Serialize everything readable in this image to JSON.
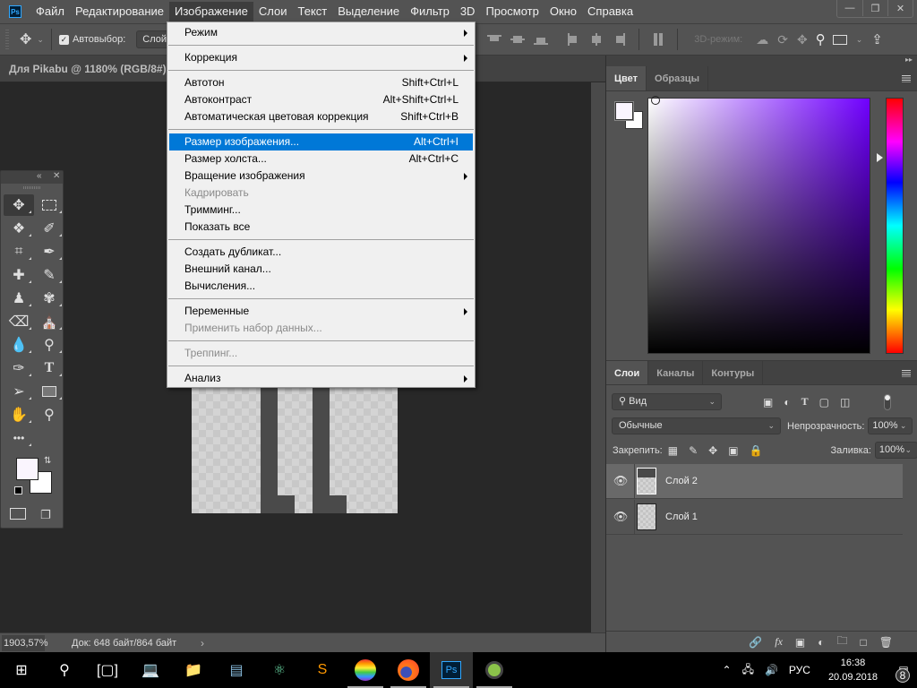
{
  "app": {
    "logo": "Ps",
    "document_title": "Для Pikabu @ 1180% (RGB/8#) *"
  },
  "menubar": {
    "items": [
      "Файл",
      "Редактирование",
      "Изображение",
      "Слои",
      "Текст",
      "Выделение",
      "Фильтр",
      "3D",
      "Просмотр",
      "Окно",
      "Справка"
    ],
    "active": "Изображение"
  },
  "window_controls": {
    "minimize": "minimize-icon",
    "restore": "restore-icon",
    "close": "close-icon"
  },
  "options_bar": {
    "autoselect_label": "Автовыбор:",
    "autoselect_checked": true,
    "autoselect_target": "Слой",
    "mode_3d_label": "3D-режим:"
  },
  "image_menu": {
    "items": [
      {
        "label": "Режим",
        "submenu": true
      },
      {
        "sep": true
      },
      {
        "label": "Коррекция",
        "submenu": true
      },
      {
        "sep": true
      },
      {
        "label": "Автотон",
        "shortcut": "Shift+Ctrl+L"
      },
      {
        "label": "Автоконтраст",
        "shortcut": "Alt+Shift+Ctrl+L"
      },
      {
        "label": "Автоматическая цветовая коррекция",
        "shortcut": "Shift+Ctrl+B"
      },
      {
        "sep": true
      },
      {
        "label": "Размер изображения...",
        "shortcut": "Alt+Ctrl+I",
        "highlighted": true
      },
      {
        "label": "Размер холста...",
        "shortcut": "Alt+Ctrl+C"
      },
      {
        "label": "Вращение изображения",
        "submenu": true
      },
      {
        "label": "Кадрировать",
        "disabled": true
      },
      {
        "label": "Тримминг..."
      },
      {
        "label": "Показать все"
      },
      {
        "sep": true
      },
      {
        "label": "Создать дубликат..."
      },
      {
        "label": "Внешний канал..."
      },
      {
        "label": "Вычисления..."
      },
      {
        "sep": true
      },
      {
        "label": "Переменные",
        "submenu": true
      },
      {
        "label": "Применить набор данных...",
        "disabled": true
      },
      {
        "sep": true
      },
      {
        "label": "Треппинг...",
        "disabled": true
      },
      {
        "sep": true
      },
      {
        "label": "Анализ",
        "submenu": true
      }
    ]
  },
  "tools": [
    "move",
    "rect-marquee",
    "polygonal-lasso",
    "quick-selection",
    "crop",
    "eyedropper",
    "healing-brush",
    "brush",
    "clone-stamp",
    "history-brush",
    "eraser",
    "paint-bucket",
    "blur",
    "dodge",
    "pen",
    "type",
    "path-selection",
    "rectangle",
    "hand-rotate",
    "zoom",
    "more"
  ],
  "swatches": {
    "foreground": "#faf5fe",
    "background": "#ffffff"
  },
  "color_panel": {
    "tabs": [
      "Цвет",
      "Образцы"
    ],
    "active_tab": "Цвет",
    "hue_color": "#7000ff"
  },
  "layers_panel": {
    "tabs": [
      "Слои",
      "Каналы",
      "Контуры"
    ],
    "active_tab": "Слои",
    "filter_label": "Вид",
    "blend_mode": "Обычные",
    "opacity_label": "Непрозрачность:",
    "opacity_value": "100%",
    "lock_label": "Закрепить:",
    "fill_label": "Заливка:",
    "fill_value": "100%",
    "layers": [
      {
        "name": "Слой 2",
        "visible": true,
        "selected": true
      },
      {
        "name": "Слой 1",
        "visible": true,
        "selected": false
      }
    ]
  },
  "status": {
    "zoom": "1903,57%",
    "doc_info": "Док: 648 байт/864 байт"
  },
  "taskbar": {
    "apps": [
      "start",
      "search",
      "task-view",
      "this-pc",
      "file-explorer",
      "terminal",
      "atom",
      "sublime",
      "color-app",
      "firefox",
      "photoshop",
      "misc-app"
    ],
    "active_app": "photoshop",
    "language": "РУС",
    "time": "16:38",
    "date": "20.09.2018",
    "notifications": "8"
  }
}
